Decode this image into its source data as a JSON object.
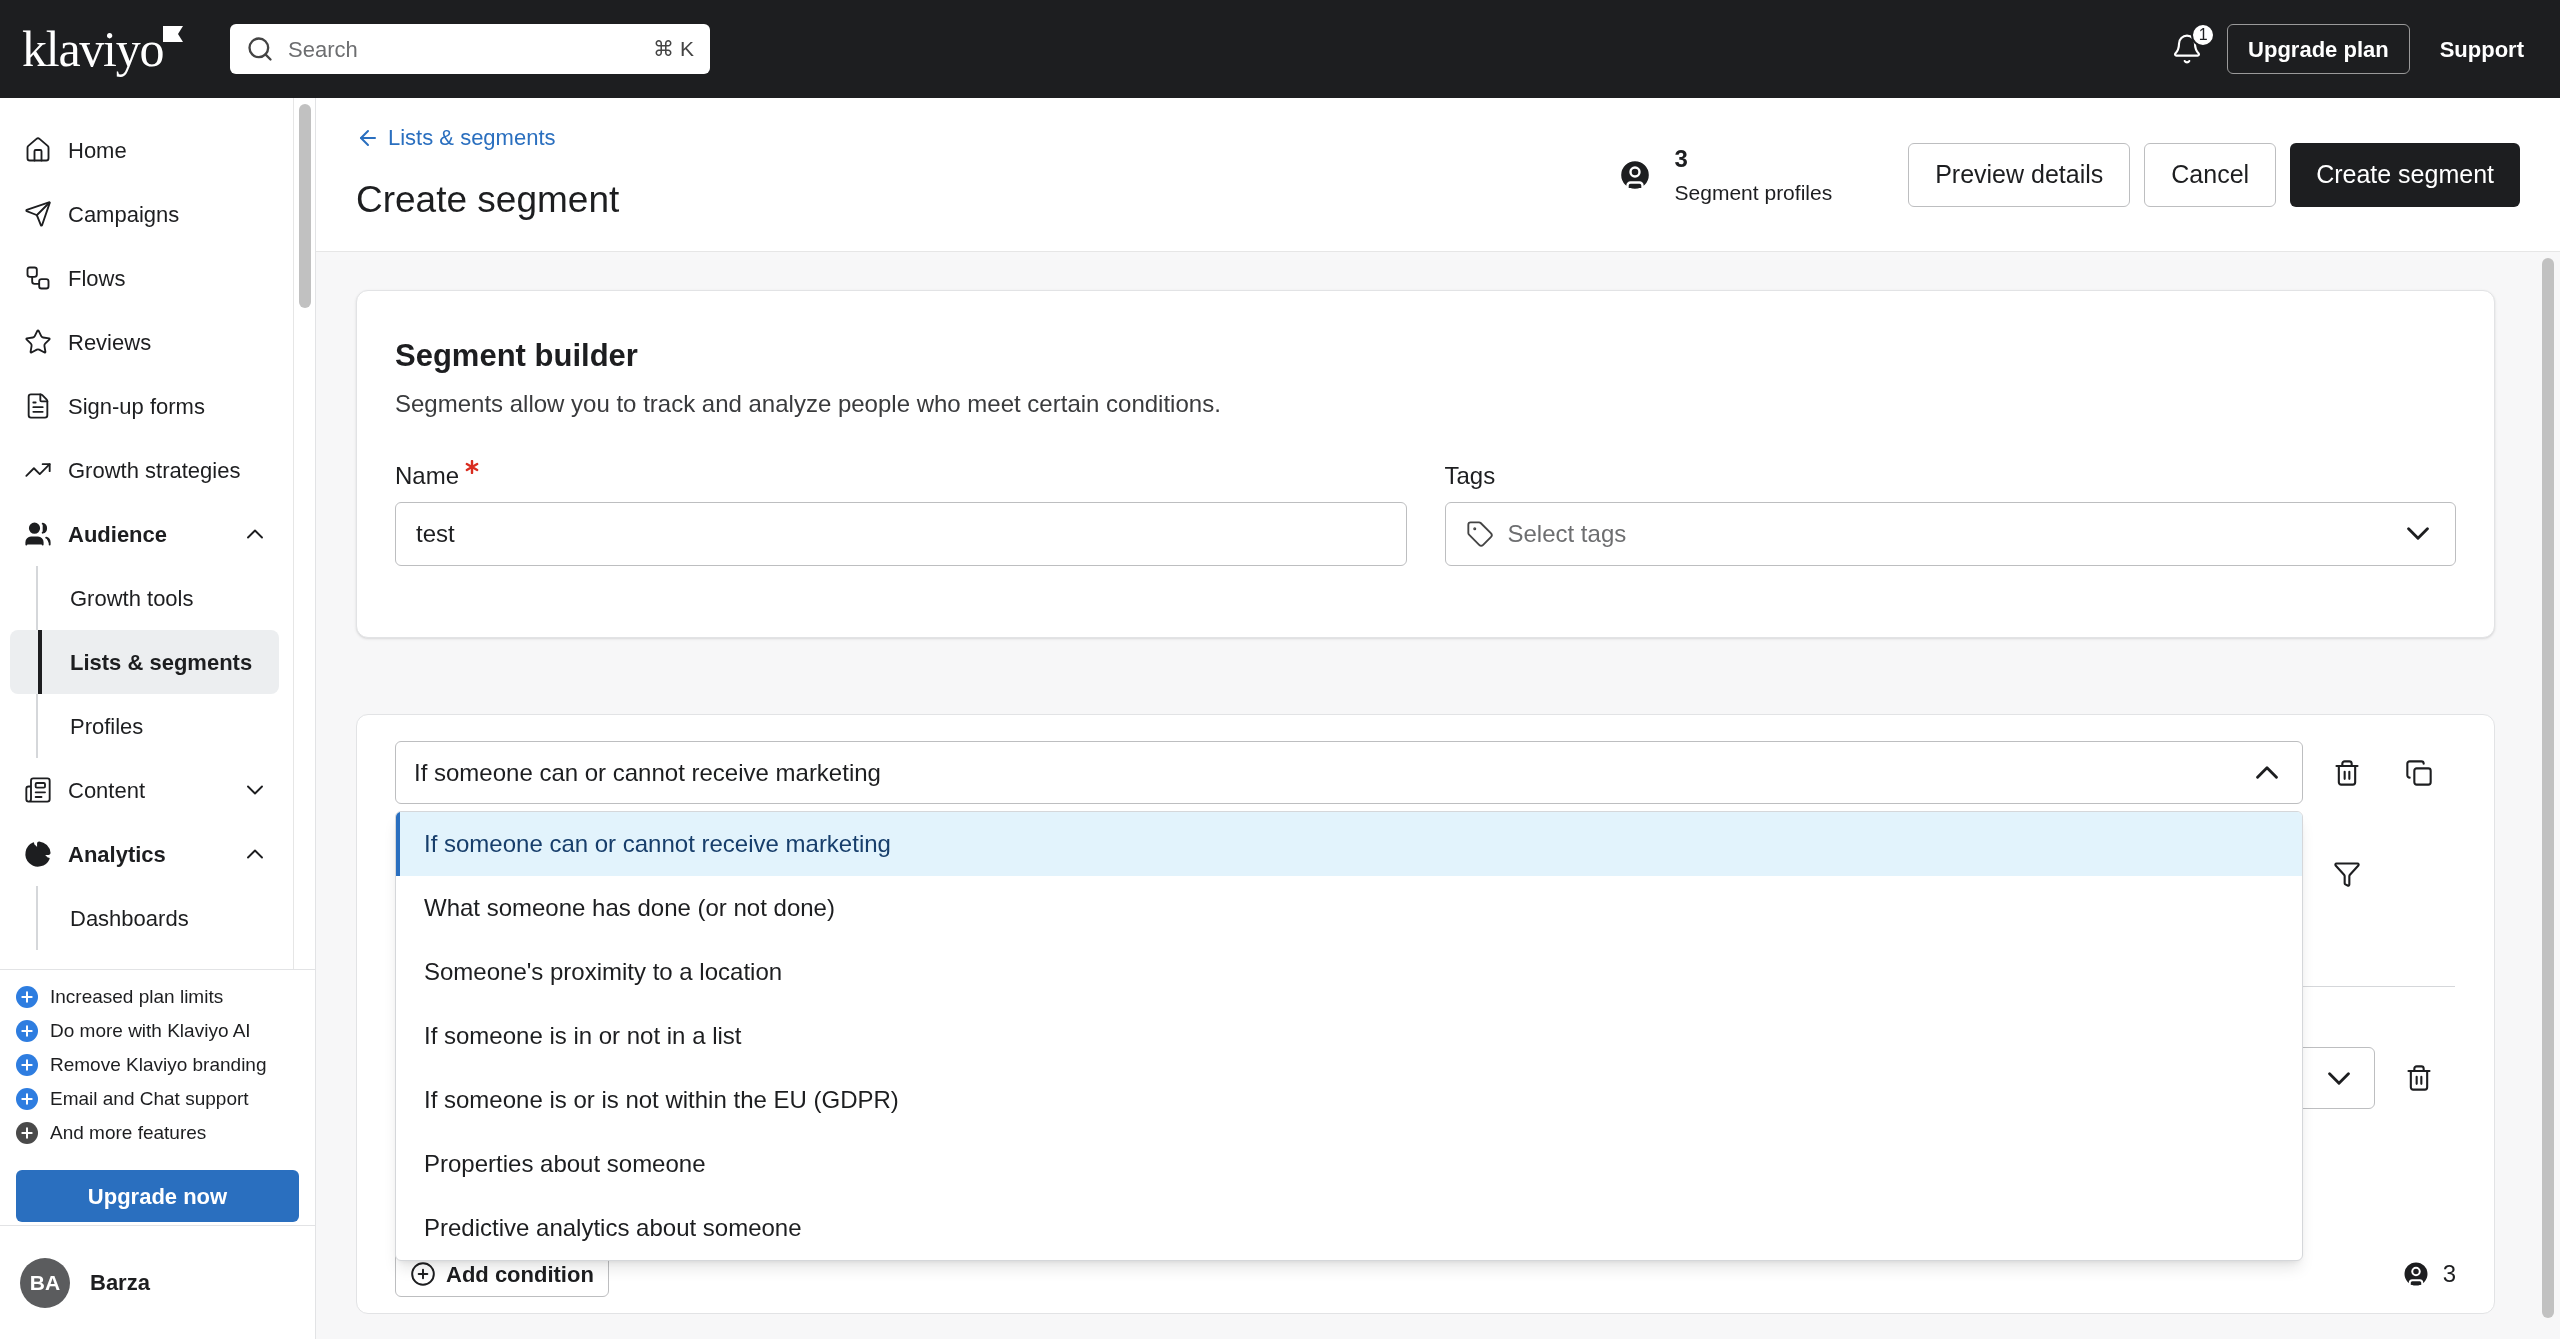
{
  "topbar": {
    "logo": "klaviyo",
    "search": {
      "placeholder": "Search",
      "shortcut": "⌘ K"
    },
    "notification_count": "1",
    "upgrade_button": "Upgrade plan",
    "support_link": "Support"
  },
  "sidebar": {
    "items": [
      {
        "label": "Home",
        "selected": false
      },
      {
        "label": "Campaigns",
        "selected": false
      },
      {
        "label": "Flows",
        "selected": false
      },
      {
        "label": "Reviews",
        "selected": false
      },
      {
        "label": "Sign-up forms",
        "selected": false
      },
      {
        "label": "Growth strategies",
        "selected": false
      },
      {
        "label": "Audience",
        "selected": false,
        "expanded": true,
        "children": [
          {
            "label": "Growth tools",
            "selected": false
          },
          {
            "label": "Lists & segments",
            "selected": true
          },
          {
            "label": "Profiles",
            "selected": false
          }
        ]
      },
      {
        "label": "Content",
        "selected": false,
        "expanded": false
      },
      {
        "label": "Analytics",
        "selected": false,
        "expanded": true,
        "children": [
          {
            "label": "Dashboards",
            "selected": false
          }
        ]
      }
    ],
    "features": [
      {
        "text": "Increased plan limits",
        "color": "#2e7de0"
      },
      {
        "text": "Do more with Klaviyo AI",
        "color": "#2e7de0"
      },
      {
        "text": "Remove Klaviyo branding",
        "color": "#2e7de0"
      },
      {
        "text": "Email and Chat support",
        "color": "#2e7de0"
      },
      {
        "text": "And more features",
        "color": "#4a4a4a"
      }
    ],
    "upgrade_button": "Upgrade now",
    "user": {
      "initials": "BA",
      "name": "Barza"
    }
  },
  "header": {
    "back_link": "Lists & segments",
    "title": "Create segment",
    "profile_count": "3",
    "profile_label": "Segment profiles",
    "buttons": [
      {
        "label": "Preview details",
        "kind": "secondary"
      },
      {
        "label": "Cancel",
        "kind": "secondary"
      },
      {
        "label": "Create segment",
        "kind": "primary"
      }
    ]
  },
  "builder": {
    "title": "Segment builder",
    "description": "Segments allow you to track and analyze people who meet certain conditions.",
    "name": {
      "label": "Name",
      "required": true,
      "value": "test"
    },
    "tags": {
      "label": "Tags",
      "placeholder": "Select tags"
    }
  },
  "conditions": {
    "select": {
      "value": "If someone can or cannot receive marketing",
      "expanded": true
    },
    "options": [
      {
        "label": "If someone can or cannot receive marketing",
        "selected": true
      },
      {
        "label": "What someone has done (or not done)",
        "selected": false
      },
      {
        "label": "Someone's proximity to a location",
        "selected": false
      },
      {
        "label": "If someone is in or not in a list",
        "selected": false
      },
      {
        "label": "If someone is or is not within the EU (GDPR)",
        "selected": false
      },
      {
        "label": "Properties about someone",
        "selected": false
      },
      {
        "label": "Predictive analytics about someone",
        "selected": false
      }
    ],
    "add_button": "Add condition",
    "count": "3"
  }
}
